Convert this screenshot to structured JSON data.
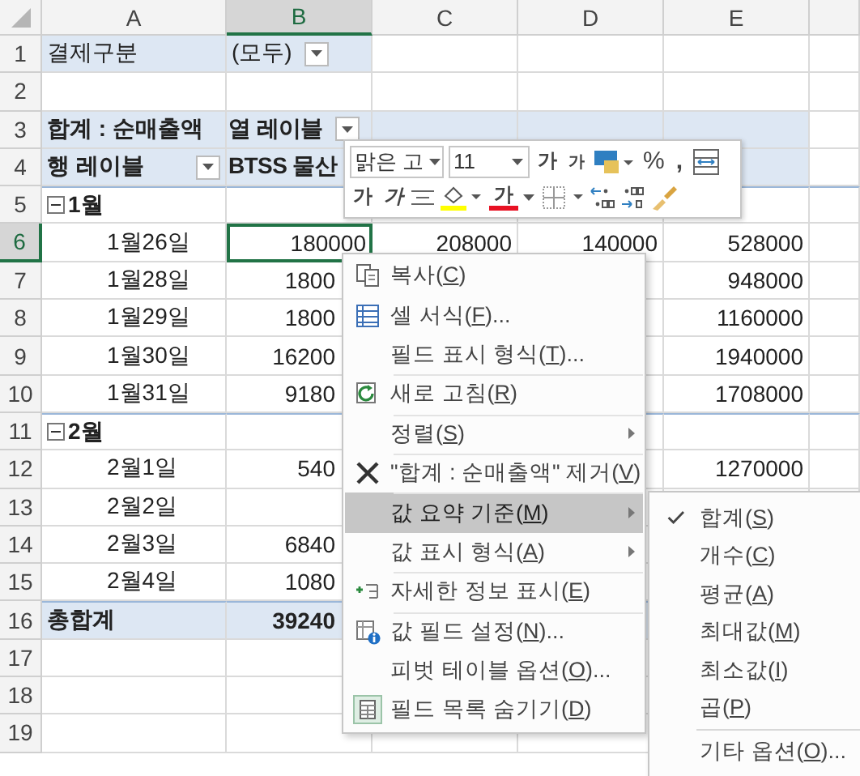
{
  "columns": [
    {
      "label": "A",
      "selected": false
    },
    {
      "label": "B",
      "selected": true
    },
    {
      "label": "C",
      "selected": false
    },
    {
      "label": "D",
      "selected": false
    },
    {
      "label": "E",
      "selected": false
    }
  ],
  "rows": [
    {
      "number": "1",
      "selected": false,
      "kind": "filter",
      "a": "결제구분",
      "b": "(모두)",
      "b_dropdown": true
    },
    {
      "number": "2",
      "selected": false,
      "kind": "blank"
    },
    {
      "number": "3",
      "selected": false,
      "kind": "header",
      "a": "합계 : 순매출액",
      "b": "열 레이블",
      "b_dropdown": true
    },
    {
      "number": "4",
      "selected": false,
      "kind": "header",
      "a": "행 레이블",
      "b": "BTSS 물산",
      "a_dropdown": true
    },
    {
      "number": "5",
      "selected": false,
      "kind": "group",
      "a": "1월",
      "expanded": true
    },
    {
      "number": "6",
      "selected": true,
      "kind": "item",
      "a": "1월26일",
      "b": "180000",
      "c": "208000",
      "d": "140000",
      "e": "528000"
    },
    {
      "number": "7",
      "selected": false,
      "kind": "item",
      "a": "1월28일",
      "b": "1800",
      "e": "948000"
    },
    {
      "number": "8",
      "selected": false,
      "kind": "item",
      "a": "1월29일",
      "b": "1800",
      "e": "1160000"
    },
    {
      "number": "9",
      "selected": false,
      "kind": "item",
      "a": "1월30일",
      "b": "16200",
      "e": "1940000"
    },
    {
      "number": "10",
      "selected": false,
      "kind": "item",
      "a": "1월31일",
      "b": "9180",
      "e": "1708000"
    },
    {
      "number": "11",
      "selected": false,
      "kind": "group",
      "a": "2월",
      "expanded": true
    },
    {
      "number": "12",
      "selected": false,
      "kind": "item",
      "a": "2월1일",
      "b": "540",
      "e": "1270000"
    },
    {
      "number": "13",
      "selected": false,
      "kind": "item",
      "a": "2월2일"
    },
    {
      "number": "14",
      "selected": false,
      "kind": "item",
      "a": "2월3일",
      "b": "6840"
    },
    {
      "number": "15",
      "selected": false,
      "kind": "item",
      "a": "2월4일",
      "b": "1080"
    },
    {
      "number": "16",
      "selected": false,
      "kind": "total",
      "a": "총합계",
      "b": "39240"
    },
    {
      "number": "17",
      "selected": false,
      "kind": "blank"
    },
    {
      "number": "18",
      "selected": false,
      "kind": "blank"
    },
    {
      "number": "19",
      "selected": false,
      "kind": "blank"
    }
  ],
  "mini_toolbar": {
    "row_1": [
      {
        "kind": "font",
        "text": "맑은 고"
      },
      {
        "kind": "size",
        "text": "11"
      },
      {
        "kind": "grow",
        "text": "가"
      },
      {
        "kind": "shrink",
        "text": "가"
      },
      {
        "kind": "accounting"
      },
      {
        "kind": "percent",
        "text": "%"
      },
      {
        "kind": "comma",
        "text": ","
      },
      {
        "kind": "merge"
      }
    ],
    "row_2": [
      {
        "kind": "bold",
        "text": "가"
      },
      {
        "kind": "italic",
        "text": "가"
      },
      {
        "kind": "align"
      },
      {
        "kind": "fill",
        "color": "#ffff00"
      },
      {
        "kind": "font-color",
        "text": "가",
        "color": "#e81123"
      },
      {
        "kind": "borders"
      },
      {
        "kind": "increase-decimal"
      },
      {
        "kind": "decrease-decimal"
      },
      {
        "kind": "format-painter"
      }
    ]
  },
  "context_menu": {
    "items": [
      {
        "text": "복사(C)",
        "kind": "copy",
        "submenu": false,
        "selected": false,
        "divider_before": false
      },
      {
        "text": "셀 서식(F)...",
        "kind": "format",
        "submenu": false,
        "selected": false,
        "divider_before": false
      },
      {
        "text": "필드 표시 형식(T)...",
        "kind": "plain",
        "submenu": false,
        "selected": false,
        "divider_before": false
      },
      {
        "text": "새로 고침(R)",
        "kind": "refresh",
        "submenu": false,
        "selected": false,
        "divider_before": true
      },
      {
        "text": "정렬(S)",
        "kind": "plain",
        "submenu": true,
        "selected": false,
        "divider_before": true
      },
      {
        "text": "\"합계 : 순매출액\" 제거(V)",
        "kind": "remove",
        "submenu": false,
        "selected": false,
        "divider_before": true
      },
      {
        "text": "값 요약 기준(M)",
        "kind": "plain",
        "submenu": true,
        "selected": true,
        "divider_before": true
      },
      {
        "text": "값 표시 형식(A)",
        "kind": "plain",
        "submenu": true,
        "selected": false,
        "divider_before": false
      },
      {
        "text": "자세한 정보 표시(E)",
        "kind": "details",
        "submenu": false,
        "selected": false,
        "divider_before": true
      },
      {
        "text": "값 필드 설정(N)...",
        "kind": "settings",
        "submenu": false,
        "selected": false,
        "divider_before": true
      },
      {
        "text": "피벗 테이블 옵션(O)...",
        "kind": "plain",
        "submenu": false,
        "selected": false,
        "divider_before": false
      },
      {
        "text": "필드 목록 숨기기(D)",
        "kind": "field-list",
        "submenu": false,
        "selected": false,
        "divider_before": false
      }
    ]
  },
  "submenu": {
    "items": [
      {
        "text": "합계(S)",
        "checked": true,
        "divider_before": false
      },
      {
        "text": "개수(C)",
        "checked": false,
        "divider_before": false
      },
      {
        "text": "평균(A)",
        "checked": false,
        "divider_before": false
      },
      {
        "text": "최대값(M)",
        "checked": false,
        "divider_before": false
      },
      {
        "text": "최소값(I)",
        "checked": false,
        "divider_before": false
      },
      {
        "text": "곱(P)",
        "checked": false,
        "divider_before": false
      },
      {
        "text": "기타 옵션(O)...",
        "checked": false,
        "divider_before": true
      }
    ]
  }
}
